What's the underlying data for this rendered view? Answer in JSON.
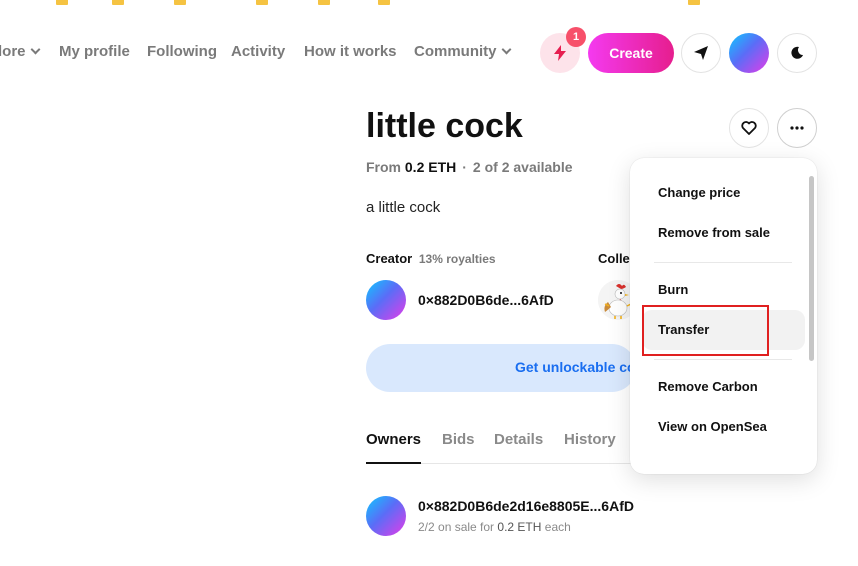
{
  "nav": {
    "explore_partial": "lore",
    "items": [
      "My profile",
      "Following",
      "Activity",
      "How it works"
    ],
    "community": "Community"
  },
  "header": {
    "notifications_count": "1",
    "create_label": "Create"
  },
  "item": {
    "title": "little cock",
    "price_prefix": "From",
    "price": "0.2 ETH",
    "availability": "2 of 2 available",
    "description": "a little cock"
  },
  "creator": {
    "label": "Creator",
    "royalties": "13% royalties",
    "address": "0×882D0B6de...6AfD"
  },
  "collection": {
    "label_partial": "Colle"
  },
  "unlock": {
    "label_partial": "Get unlockable co"
  },
  "tabs": [
    "Owners",
    "Bids",
    "Details",
    "History"
  ],
  "owner": {
    "address": "0×882D0B6de2d16e8805E...6AfD",
    "sale_prefix": "2/2 on sale for",
    "sale_price": "0.2 ETH",
    "sale_suffix": "each"
  },
  "menu": {
    "items": [
      "Change price",
      "Remove from sale",
      "Burn",
      "Transfer",
      "Remove Carbon",
      "View on OpenSea"
    ]
  },
  "colors": {
    "accent_pink": "#e61e8e",
    "unlock_bg": "#d9e8fd",
    "unlock_text": "#1a6ef0",
    "highlight": "#e02020"
  }
}
